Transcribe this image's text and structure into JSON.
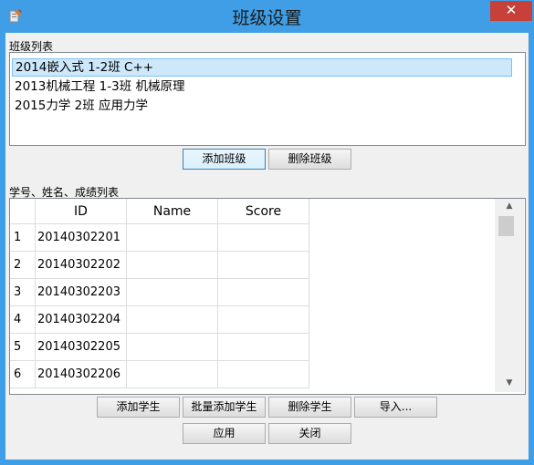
{
  "window": {
    "title": "班级设置",
    "close_glyph": "✕",
    "icon": "app-icon"
  },
  "class_list": {
    "label": "班级列表",
    "items": [
      {
        "label": "2014嵌入式 1-2班 C++",
        "selected": true
      },
      {
        "label": "2013机械工程 1-3班 机械原理",
        "selected": false
      },
      {
        "label": "2015力学 2班 应用力学",
        "selected": false
      }
    ],
    "add_label": "添加班级",
    "delete_label": "删除班级"
  },
  "student_grid": {
    "label": "学号、姓名、成绩列表",
    "columns": [
      "ID",
      "Name",
      "Score"
    ],
    "rows": [
      {
        "num": "1",
        "id": "20140302201",
        "name": "",
        "score": ""
      },
      {
        "num": "2",
        "id": "20140302202",
        "name": "",
        "score": ""
      },
      {
        "num": "3",
        "id": "20140302203",
        "name": "",
        "score": ""
      },
      {
        "num": "4",
        "id": "20140302204",
        "name": "",
        "score": ""
      },
      {
        "num": "5",
        "id": "20140302205",
        "name": "",
        "score": ""
      },
      {
        "num": "6",
        "id": "20140302206",
        "name": "",
        "score": ""
      }
    ],
    "scroll_up": "▲",
    "scroll_down": "▼"
  },
  "buttons": {
    "add_student": "添加学生",
    "batch_add_student": "批量添加学生",
    "delete_student": "删除学生",
    "import": "导入...",
    "apply": "应用",
    "close": "关闭"
  }
}
